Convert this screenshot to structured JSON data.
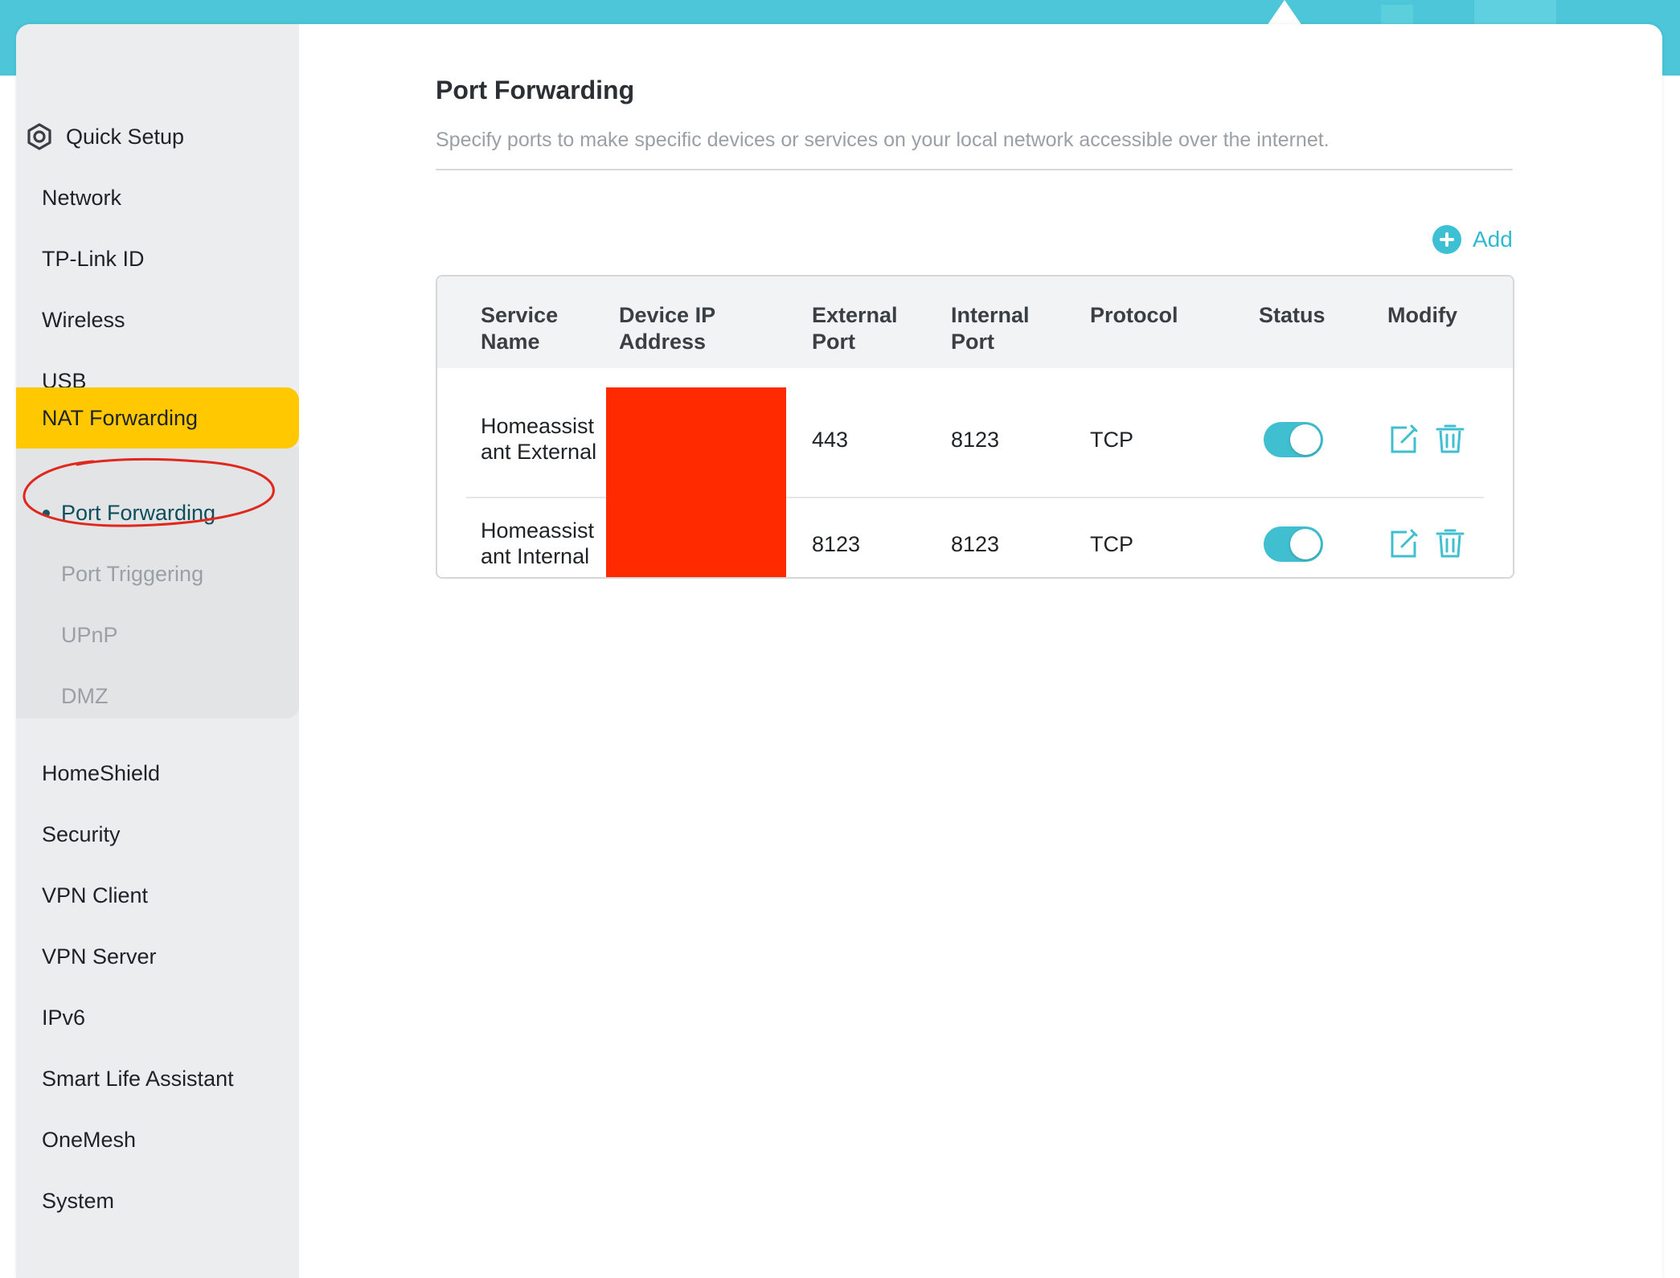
{
  "sidebar": {
    "items": [
      {
        "label": "Quick Setup",
        "icon": "gear-icon"
      },
      {
        "label": "Network"
      },
      {
        "label": "TP-Link ID"
      },
      {
        "label": "Wireless"
      },
      {
        "label": "USB"
      },
      {
        "label": "NAT Forwarding",
        "active": true
      },
      {
        "label": "HomeShield"
      },
      {
        "label": "Security"
      },
      {
        "label": "VPN Client"
      },
      {
        "label": "VPN Server"
      },
      {
        "label": "IPv6"
      },
      {
        "label": "Smart Life Assistant"
      },
      {
        "label": "OneMesh"
      },
      {
        "label": "System"
      }
    ],
    "sub_items": [
      {
        "label": "Port Forwarding",
        "active": true
      },
      {
        "label": "Port Triggering"
      },
      {
        "label": "UPnP"
      },
      {
        "label": "DMZ"
      }
    ]
  },
  "page": {
    "title": "Port Forwarding",
    "description": "Specify ports to make specific devices or services on your local network accessible over the internet.",
    "add_label": "Add"
  },
  "table": {
    "headers": {
      "service_name_1": "Service",
      "service_name_2": "Name",
      "device_ip_1": "Device IP",
      "device_ip_2": "Address",
      "external_port_1": "External",
      "external_port_2": "Port",
      "internal_port_1": "Internal",
      "internal_port_2": "Port",
      "protocol": "Protocol",
      "status": "Status",
      "modify": "Modify"
    },
    "rows": [
      {
        "service_line1": "Homeassist",
        "service_line2": "ant External",
        "external_port": "443",
        "internal_port": "8123",
        "protocol": "TCP",
        "status_on": true
      },
      {
        "service_line1": "Homeassist",
        "service_line2": "ant Internal",
        "external_port": "8123",
        "internal_port": "8123",
        "protocol": "TCP",
        "status_on": true
      }
    ]
  },
  "colors": {
    "accent": "#3fbfd0",
    "active_nav": "#ffc800",
    "redaction": "#ff2a00",
    "annotation": "#e0281e"
  }
}
